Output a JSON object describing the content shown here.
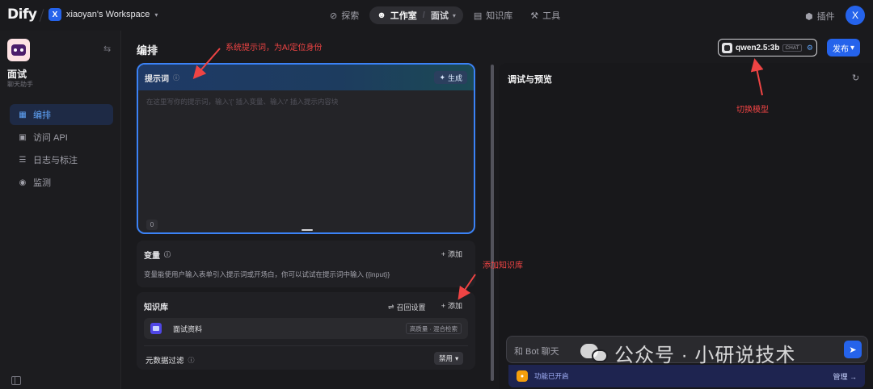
{
  "topbar": {
    "logo": "Dify",
    "workspace_initial": "X",
    "workspace_name": "xiaoyan's Workspace",
    "nav": [
      {
        "label": "探索",
        "icon": "compass-icon"
      },
      {
        "label": "工作室",
        "icon": "robot-icon",
        "sub": "面试"
      },
      {
        "label": "知识库",
        "icon": "book-icon"
      },
      {
        "label": "工具",
        "icon": "hammer-icon"
      }
    ],
    "plugin_label": "插件",
    "user_initial": "X"
  },
  "sidebar": {
    "app_name": "面试",
    "app_type": "聊天助手",
    "items": [
      {
        "label": "编排",
        "icon": "layout-icon",
        "active": true
      },
      {
        "label": "访问 API",
        "icon": "terminal-icon"
      },
      {
        "label": "日志与标注",
        "icon": "log-icon"
      },
      {
        "label": "监测",
        "icon": "monitor-icon"
      }
    ]
  },
  "main": {
    "title": "编排",
    "prompt": {
      "title": "提示词",
      "generate_label": "生成",
      "placeholder": "在这里写你的提示词，输入'{' 插入变量、输入'/' 插入提示内容块",
      "count": "0"
    },
    "variables": {
      "title": "变量",
      "add_label": "添加",
      "description": "变量能使用户输入表单引入提示词或开场白，你可以试试在提示词中输入 {{input}}"
    },
    "knowledge": {
      "title": "知识库",
      "recall_label": "召回设置",
      "add_label": "添加",
      "item_name": "面试资料",
      "item_tag": "高质量 · 混合检索",
      "meta_label": "元数据过滤",
      "meta_value": "禁用"
    }
  },
  "right": {
    "model_name": "qwen2.5:3b",
    "model_tag": "CHAT",
    "publish_label": "发布",
    "debug_title": "调试与预览",
    "chat_placeholder": "和 Bot 聊天",
    "feature_text": "功能已开启",
    "manage_label": "管理"
  },
  "annotations": {
    "prompt_note": "系统提示词，为AI定位身份",
    "model_note": "切换模型",
    "kb_note": "添加知识库"
  },
  "watermark": {
    "text": "公众号 · 小研说技术"
  },
  "colors": {
    "accent": "#2563eb",
    "annotation": "#ef4444",
    "background": "#1a1a1d"
  }
}
